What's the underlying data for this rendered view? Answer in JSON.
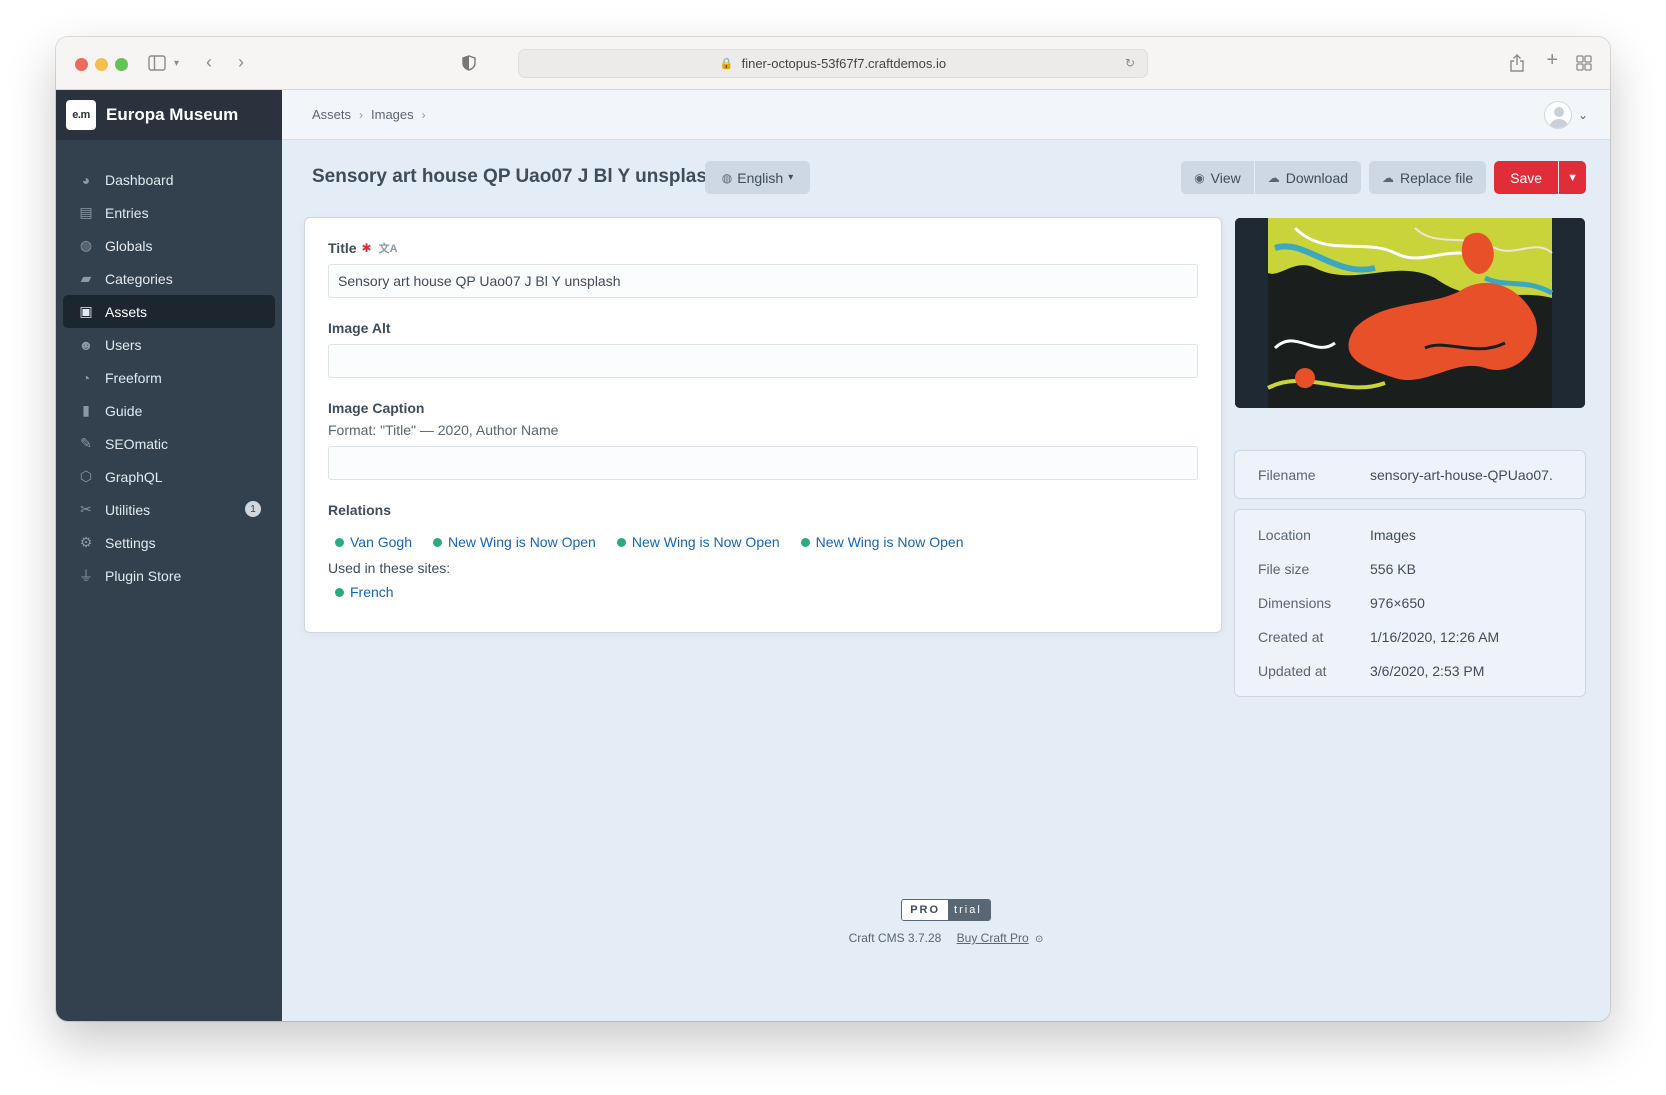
{
  "browser": {
    "url": "finer-octopus-53f67f7.craftdemos.io"
  },
  "brand": {
    "logo_text": "e.m",
    "name": "Europa Museum"
  },
  "nav": [
    {
      "label": "Dashboard",
      "icon": "dashboard-icon"
    },
    {
      "label": "Entries",
      "icon": "entries-icon"
    },
    {
      "label": "Globals",
      "icon": "globe-icon"
    },
    {
      "label": "Categories",
      "icon": "folder-icon"
    },
    {
      "label": "Assets",
      "icon": "image-icon",
      "active": true
    },
    {
      "label": "Users",
      "icon": "users-icon"
    },
    {
      "label": "Freeform",
      "icon": "freeform-icon"
    },
    {
      "label": "Guide",
      "icon": "book-icon"
    },
    {
      "label": "SEOmatic",
      "icon": "seomatic-icon"
    },
    {
      "label": "GraphQL",
      "icon": "graphql-icon"
    },
    {
      "label": "Utilities",
      "icon": "wrench-icon",
      "badge": "1"
    },
    {
      "label": "Settings",
      "icon": "gear-icon"
    },
    {
      "label": "Plugin Store",
      "icon": "plug-icon"
    }
  ],
  "breadcrumbs": [
    "Assets",
    "Images"
  ],
  "page": {
    "title": "Sensory art house QP Uao07 J Bl Y unsplash",
    "site_selector": "English"
  },
  "actions": {
    "view": "View",
    "download": "Download",
    "replace": "Replace file",
    "save": "Save"
  },
  "fields": {
    "title_label": "Title",
    "title_value": "Sensory art house QP Uao07 J Bl Y unsplash",
    "alt_label": "Image Alt",
    "alt_value": "",
    "caption_label": "Image Caption",
    "caption_instructions": "Format: \"Title\" — 2020, Author Name",
    "caption_value": "",
    "relations_label": "Relations",
    "relations": [
      "Van Gogh",
      "New Wing is Now Open",
      "New Wing is Now Open",
      "New Wing is Now Open"
    ],
    "used_label": "Used in these sites:",
    "sites": [
      "French"
    ]
  },
  "meta": {
    "filename_label": "Filename",
    "filename": "sensory-art-house-QPUao07.",
    "rows": [
      {
        "label": "Location",
        "value": "Images"
      },
      {
        "label": "File size",
        "value": "556 KB"
      },
      {
        "label": "Dimensions",
        "value": "976×650"
      },
      {
        "label": "Created at",
        "value": "1/16/2020, 12:26 AM"
      },
      {
        "label": "Updated at",
        "value": "3/6/2020, 2:53 PM"
      }
    ]
  },
  "footer": {
    "edition": "PRO",
    "trial": "trial",
    "version": "Craft CMS 3.7.28",
    "buy": "Buy Craft Pro"
  },
  "colors": {
    "accent": "#e12d39",
    "sidebar": "#33404d",
    "link": "#1565b8",
    "status_green": "#27ab83"
  }
}
